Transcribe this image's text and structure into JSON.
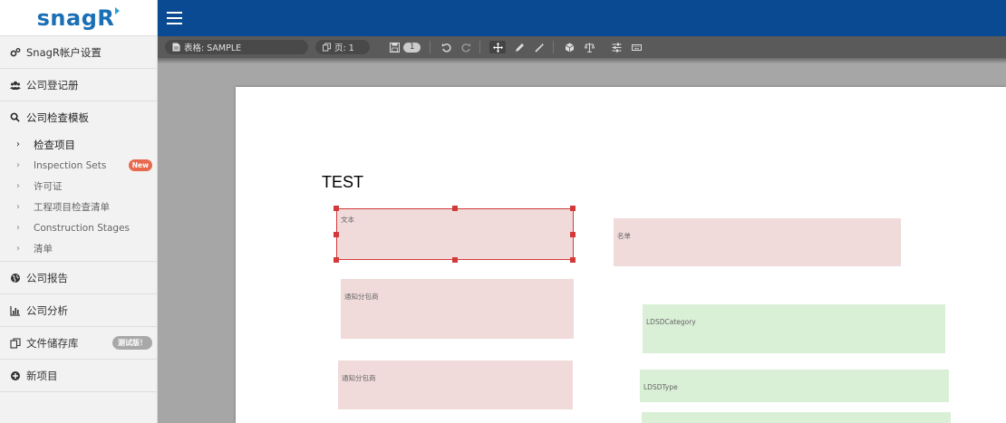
{
  "logo": {
    "text_main": "snagR"
  },
  "sidebar": {
    "account_settings": "SnagR帐户设置",
    "company_register": "公司登记册",
    "inspection_templates": {
      "title": "公司检查模板",
      "items": [
        {
          "label": "检查项目",
          "active": true
        },
        {
          "label": "Inspection Sets",
          "badge": "New"
        },
        {
          "label": "许可证"
        },
        {
          "label": "工程项目检查清单"
        },
        {
          "label": "Construction Stages"
        },
        {
          "label": "清单"
        }
      ]
    },
    "company_reports": "公司报告",
    "company_analytics": "公司分析",
    "file_storage": {
      "label": "文件储存库",
      "badge": "测试版！"
    },
    "new_project": "新项目"
  },
  "toolbar": {
    "form_label": "表格: SAMPLE",
    "page_label": "页: 1",
    "save_count": "1"
  },
  "document": {
    "title": "TEST",
    "fields": [
      {
        "label": "文本",
        "color": "red",
        "selected": true
      },
      {
        "label": "名单",
        "color": "red"
      },
      {
        "label": "通知分包商",
        "color": "red"
      },
      {
        "label": "LDSDCategory",
        "color": "green"
      },
      {
        "label": "通知分包商",
        "color": "red"
      },
      {
        "label": "LDSDType",
        "color": "green"
      },
      {
        "label": "",
        "color": "green"
      }
    ]
  },
  "colors": {
    "topbar": "#0a4a92",
    "toolbar": "#5a5a5a",
    "field_red": "#f0dada",
    "field_green": "#d9efd6",
    "selection": "#d23a3a",
    "badge_new": "#e86a4e"
  }
}
